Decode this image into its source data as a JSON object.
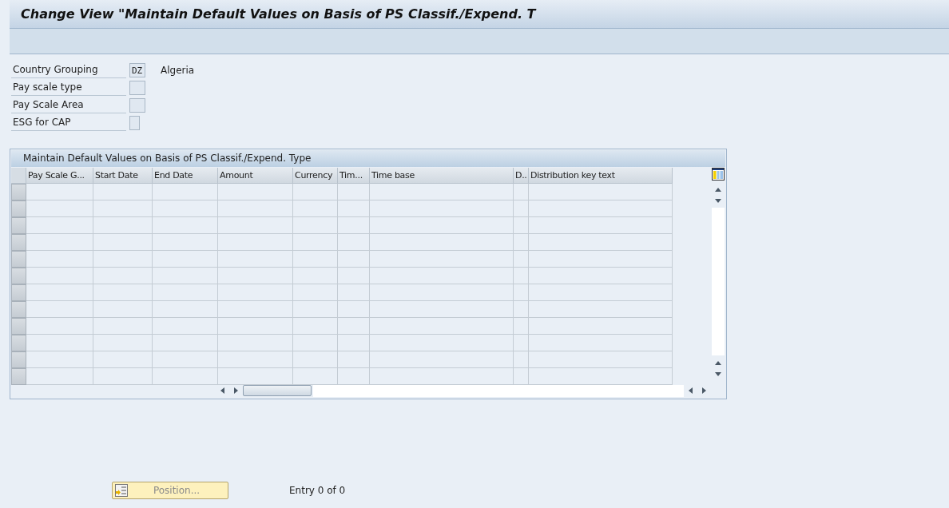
{
  "window": {
    "title": "Change View \"Maintain Default Values on Basis of PS Classif./Expend. T"
  },
  "fields": [
    {
      "label": "Country Grouping",
      "value": "DZ",
      "description": "Algeria",
      "kind": "wide"
    },
    {
      "label": "Pay scale type",
      "kind": "wide"
    },
    {
      "label": "Pay Scale Area",
      "kind": "wide"
    },
    {
      "label": "ESG for CAP",
      "kind": "narrow"
    }
  ],
  "table": {
    "title": "Maintain Default Values on Basis of PS Classif./Expend. Type",
    "columns": [
      "Pay Scale G...",
      "Start Date",
      "End Date",
      "Amount",
      "Currency",
      "Tim...",
      "Time base",
      "D..",
      "Distribution key text"
    ]
  },
  "footer": {
    "position_button": {
      "label": "Position...",
      "disabled": true
    },
    "entry_count": "Entry 0 of 0"
  }
}
